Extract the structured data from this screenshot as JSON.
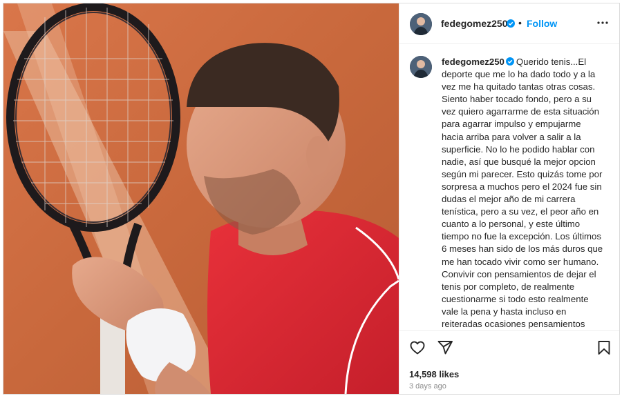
{
  "post": {
    "username": "fedegomez250",
    "verified": true,
    "follow_label": "Follow",
    "separator": "•",
    "caption": "Querido tenis...El deporte que me lo ha dado todo y a la vez me ha quitado tantas otras cosas. Siento haber tocado fondo, pero a su vez quiero agarrarme de esta situación para agarrar impulso y empujarme hacia arriba para volver a salir a la superficie. No lo he podido hablar con nadie, así que busqué la mejor opcion según mi parecer. Esto quizás tome por sorpresa a muchos pero el 2024 fue sin dudas el mejor año de mi carrera tenística, pero a su vez, el peor año en cuanto a lo personal, y este último tiempo no fue la excepción. Los últimos 6 meses han sido de los más duros que me han tocado vivir como ser humano. Convivir con pensamientos de dejar el tenis por completo, de realmente cuestionarme si todo esto realmente vale la pena y hasta incluso en reiteradas ocasiones pensamientos",
    "likes": "14,598 likes",
    "timestamp": "3 days ago"
  },
  "icons": {
    "verified": "verified-badge-icon",
    "more": "more-options-icon",
    "like": "heart-icon",
    "share": "share-icon",
    "save": "bookmark-icon"
  },
  "colors": {
    "accent": "#0095f6",
    "text": "#262626",
    "muted": "#8e8e8e",
    "border": "#dbdbdb",
    "clay": "#c96a3e"
  }
}
